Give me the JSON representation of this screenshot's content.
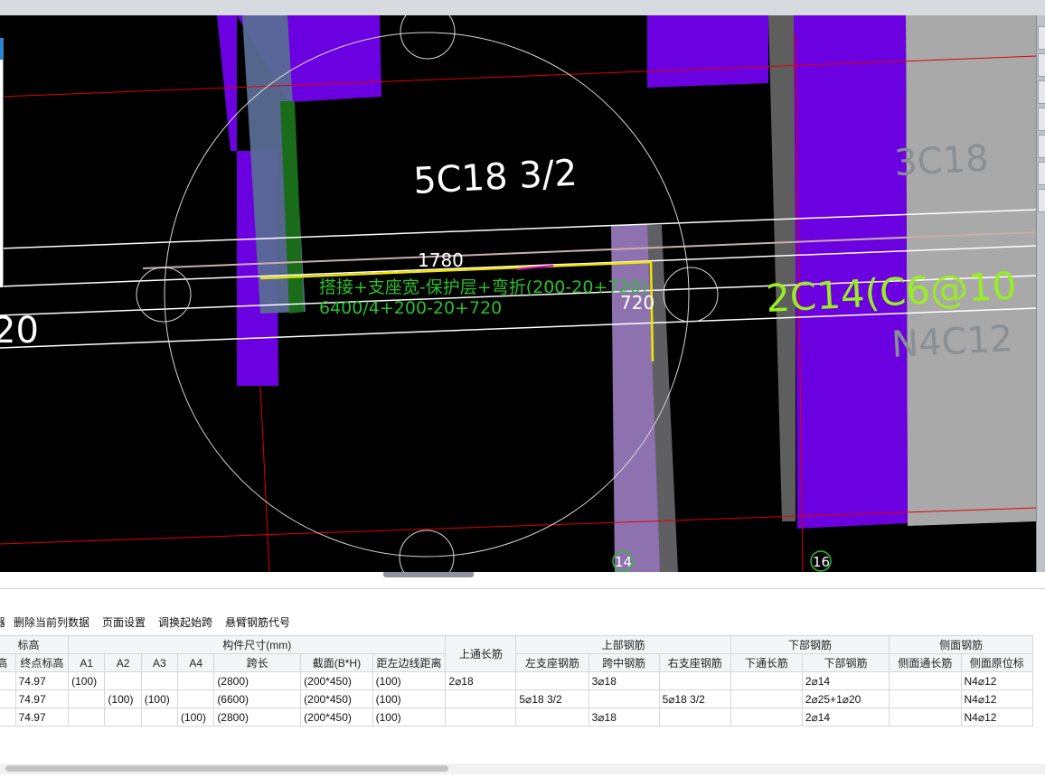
{
  "viewport": {
    "labels": {
      "main_rebar": "5C18 3/2",
      "right_rebar": "3C18",
      "stirrup": "2C14(C6@10",
      "side_rebar": "N4C12",
      "left_partial": "20",
      "dim_top": "1780",
      "dim_right": "720",
      "formula_line1": "搭接+支座宽-保护层+弯折(200-20+720)",
      "formula_line2": "6400/4+200-20+720",
      "axis_14": "14",
      "axis_16": "16"
    },
    "colors": {
      "background": "#000000",
      "beam_violet": "#6b00e0",
      "column_grey": "#a9a9a9",
      "highlight_yellow": "#f2e600",
      "formula_green": "#2bbf2b",
      "rebar_lime": "#99ee22",
      "grid_red": "#e00000"
    }
  },
  "toolbar": {
    "items": [
      "删除当前列数据",
      "页面设置",
      "调换起始跨",
      "悬臂钢筋代号"
    ]
  },
  "grid": {
    "header1": {
      "col0": "标高",
      "size": "构件尺寸(mm)",
      "top_through": "上通长筋",
      "top_rebar": "上部钢筋",
      "bottom_rebar": "下部钢筋",
      "side_rebar": "侧面钢筋"
    },
    "header2": [
      "高",
      "终点标高",
      "A1",
      "A2",
      "A3",
      "A4",
      "跨长",
      "截面(B*H)",
      "距左边线距离",
      "左支座钢筋",
      "跨中钢筋",
      "右支座钢筋",
      "下通长筋",
      "下部钢筋",
      "侧面通长筋",
      "侧面原位标"
    ],
    "rows": [
      [
        "",
        "74.97",
        "(100)",
        "",
        "",
        "",
        "(2800)",
        "(200*450)",
        "(100)",
        "2⌀18",
        "",
        "3⌀18",
        "",
        "",
        "2⌀14",
        "",
        "N4⌀12"
      ],
      [
        "",
        "74.97",
        "",
        "(100)",
        "(100)",
        "",
        "(6600)",
        "(200*450)",
        "(100)",
        "",
        "5⌀18 3/2",
        "",
        "5⌀18 3/2",
        "",
        "2⌀25+1⌀20",
        "",
        "N4⌀12"
      ],
      [
        "",
        "74.97",
        "",
        "",
        "",
        "(100)",
        "(2800)",
        "(200*450)",
        "(100)",
        "",
        "",
        "3⌀18",
        "",
        "",
        "2⌀14",
        "",
        "N4⌀12"
      ]
    ]
  }
}
